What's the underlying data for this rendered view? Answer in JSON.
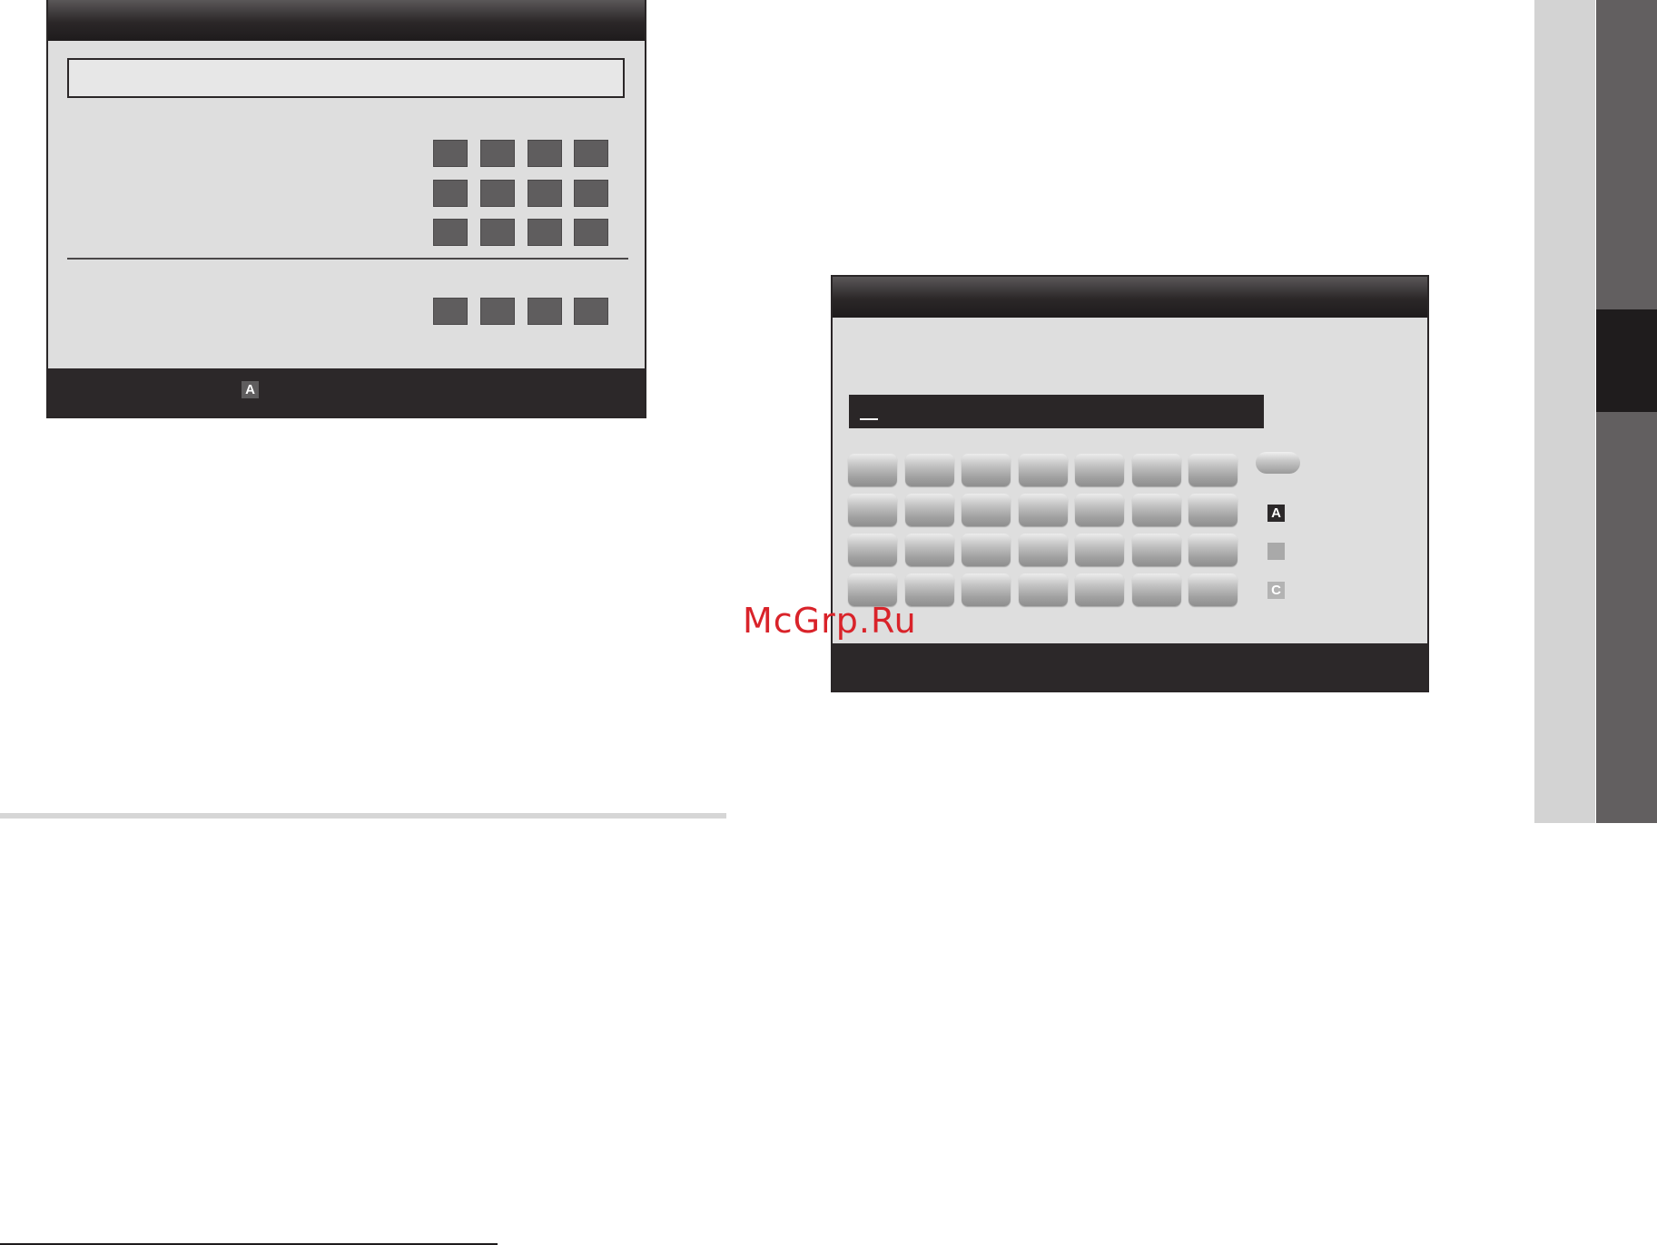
{
  "ip_dialog": {
    "title": "",
    "field_value": "",
    "footer_key_badge": "A",
    "rows": 4
  },
  "keyboard_dialog": {
    "title": "",
    "input_value": "",
    "key_rows": 4,
    "key_cols": 7,
    "side_keys": [
      {
        "badge": "A",
        "color": "#2b2829"
      },
      {
        "badge": "",
        "color": "#a9a9a9"
      },
      {
        "badge": "C",
        "color": "#b3b3b3"
      }
    ]
  },
  "watermark_text": "McGrp.Ru",
  "colors": {
    "panel_bg": "#dedede",
    "titlebar": "#2b2728",
    "footer": "#2c2829",
    "cell": "#5f5d5e",
    "watermark": "#d9232a",
    "side_tab_active": "#1f1c1d"
  }
}
